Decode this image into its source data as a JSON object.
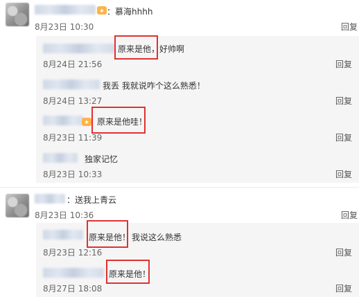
{
  "comments": [
    {
      "text": "：慕海hhhh",
      "time": "8月23日 10:30",
      "reply_label": "回复",
      "replies": [
        {
          "text_highlight": "原来是他，",
          "text_rest": "好帅啊",
          "time": "8月24日 21:56",
          "reply_label": "回复"
        },
        {
          "text": "我丢 我就说咋个这么熟悉！",
          "time": "8月24日 13:27",
          "reply_label": "回复"
        },
        {
          "text_highlight": "原来是他哇！",
          "time": "8月23日 11:39",
          "reply_label": "回复"
        },
        {
          "text": "独家记忆",
          "time": "8月23日 10:33",
          "reply_label": "回复"
        }
      ]
    },
    {
      "text": "：送我上青云",
      "time": "8月23日 10:36",
      "reply_label": "回复",
      "replies": [
        {
          "text_highlight": "原来是他！",
          "text_rest": "我说这么熟悉",
          "time": "8月23日 12:16",
          "reply_label": "回复"
        },
        {
          "text_highlight": "原来是他！",
          "time": "8月27日 18:08",
          "reply_label": "回复"
        }
      ]
    }
  ],
  "colors": {
    "highlight_box": "#e03030",
    "reply_background": "#f5f5f5"
  }
}
